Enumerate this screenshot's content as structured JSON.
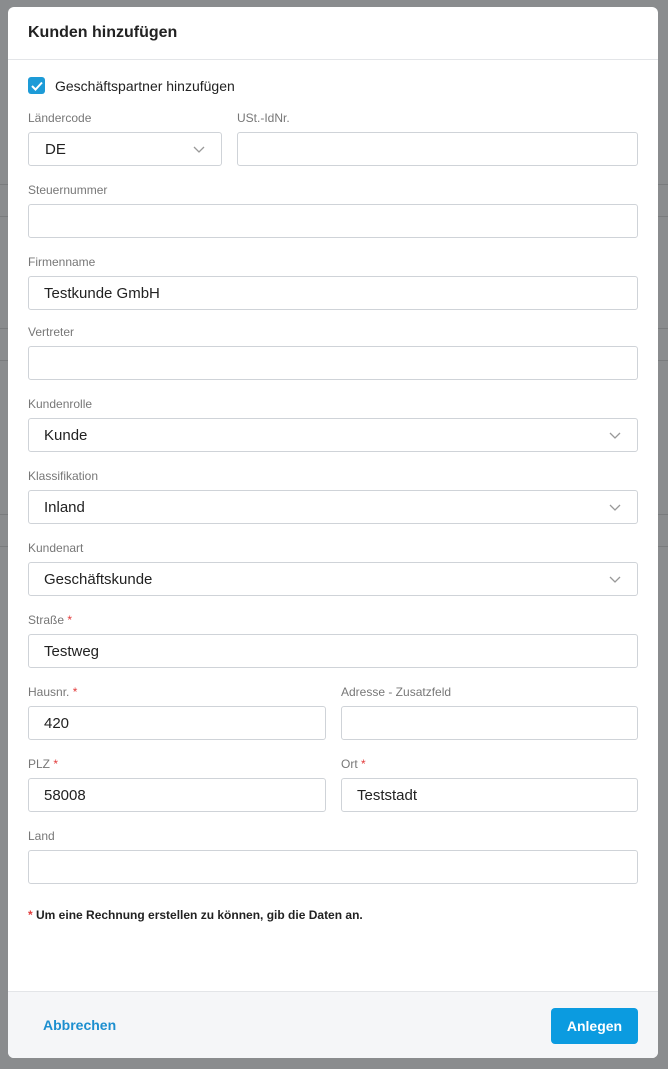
{
  "modal": {
    "title": "Kunden hinzufügen",
    "checkbox": {
      "label": "Geschäftspartner hinzufügen",
      "checked": true
    },
    "fields": {
      "laendercode": {
        "label": "Ländercode",
        "value": "DE"
      },
      "ust_id": {
        "label": "USt.-IdNr.",
        "value": ""
      },
      "steuernummer": {
        "label": "Steuernummer",
        "value": ""
      },
      "firmenname": {
        "label": "Firmenname",
        "value": "Testkunde GmbH"
      },
      "vertreter": {
        "label": "Vertreter",
        "value": ""
      },
      "kundenrolle": {
        "label": "Kundenrolle",
        "value": "Kunde"
      },
      "klassifikation": {
        "label": "Klassifikation",
        "value": "Inland"
      },
      "kundenart": {
        "label": "Kundenart",
        "value": "Geschäftskunde"
      },
      "strasse": {
        "label": "Straße",
        "required_mark": "*",
        "value": "Testweg"
      },
      "hausnr": {
        "label": "Hausnr.",
        "required_mark": "*",
        "value": "420"
      },
      "adresse_zusatz": {
        "label": "Adresse - Zusatzfeld",
        "value": ""
      },
      "plz": {
        "label": "PLZ",
        "required_mark": "*",
        "value": "58008"
      },
      "ort": {
        "label": "Ort",
        "required_mark": "*",
        "value": "Teststadt"
      },
      "land": {
        "label": "Land",
        "value": ""
      }
    },
    "note": {
      "mark": "*",
      "text": "Um eine Rechnung erstellen zu können, gib die Daten an."
    },
    "footer": {
      "cancel_label": "Abbrechen",
      "submit_label": "Anlegen"
    }
  },
  "colors": {
    "accent": "#0b9be0",
    "required": "#e23b3b"
  }
}
